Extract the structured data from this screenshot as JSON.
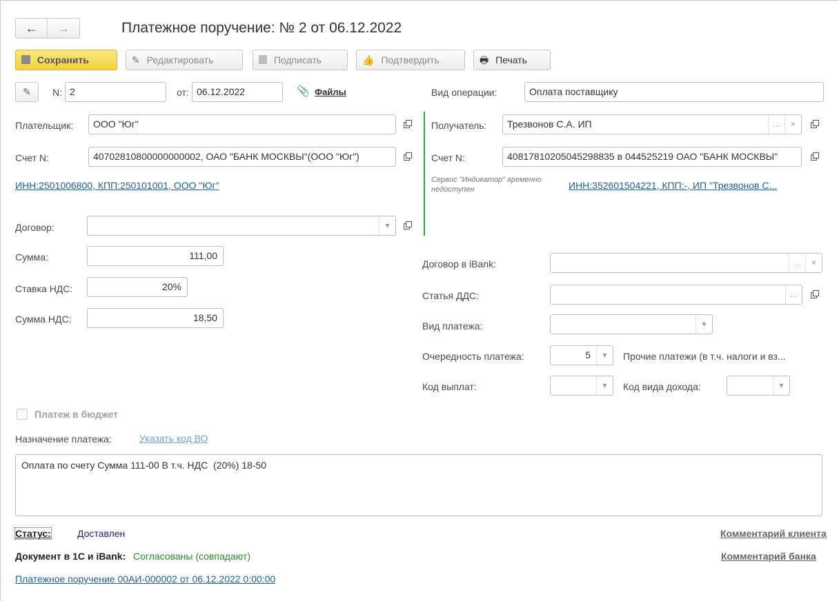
{
  "window": {
    "title": "Платежное поручение: № 2 от 06.12.2022"
  },
  "nav": {
    "back_icon": "arrow-left-icon",
    "forward_icon": "arrow-right-icon"
  },
  "toolbar": {
    "save": "Сохранить",
    "edit": "Редактировать",
    "sign": "Подписать",
    "confirm": "Подтвердить",
    "print": "Печать"
  },
  "doc": {
    "number_label": "N:",
    "number": "2",
    "date_label": "от:",
    "date": "06.12.2022",
    "files": "Файлы"
  },
  "operation": {
    "label": "Вид операции:",
    "value": "Оплата поставщику"
  },
  "payer": {
    "label": "Плательщик:",
    "value": "ООО \"Юг\"",
    "account_label": "Счет N:",
    "account": "40702810800000000002, ОАО \"БАНК МОСКВЫ\"(ООО \"Юг\")",
    "inn_link": "ИНН:2501006800, КПП:250101001, ООО \"Юг\""
  },
  "recipient": {
    "label": "Получатель:",
    "value": "Трезвонов С.А. ИП",
    "account_label": "Счет N:",
    "account": "40817810205045298835 в 044525219 ОАО \"БАНК МОСКВЫ\"",
    "service_note": "Сервис \"Индикатор\" временно недоступен",
    "inn_link": "ИНН:352601504221, КПП:-, ИП \"Трезвонов С..."
  },
  "contract": {
    "label": "Договор:",
    "value": ""
  },
  "amounts": {
    "sum_label": "Сумма:",
    "sum": "111,00",
    "vat_rate_label": "Ставка НДС:",
    "vat_rate": "20%",
    "vat_sum_label": "Сумма НДС:",
    "vat_sum": "18,50"
  },
  "ibank": {
    "contract_label": "Договор в iBank:",
    "contract": "",
    "dds_label": "Статья ДДС:",
    "dds": "",
    "payment_type_label": "Вид платежа:",
    "payment_type": "",
    "priority_label": "Очередность платежа:",
    "priority": "5",
    "priority_desc": "Прочие платежи (в т.ч. налоги и вз...",
    "payout_code_label": "Код выплат:",
    "payout_code": "",
    "income_code_label": "Код вида дохода:",
    "income_code": ""
  },
  "budget": {
    "label": "Платеж в бюджет",
    "checked": false
  },
  "purpose": {
    "label": "Назначение платежа:",
    "link": "Указать код ВО",
    "text": "Оплата по счету Сумма 111-00 В т.ч. НДС  (20%) 18-50"
  },
  "status": {
    "label": "Статус:",
    "value": "Доставлен",
    "compare_label": "Документ в 1С и iBank:",
    "compare_value": "Согласованы (совпадают)",
    "client_comment": "Комментарий клиента",
    "bank_comment": "Комментарий банка",
    "doc_link": "Платежное поручение 00АИ-000002 от 06.12.2022 0:00:00"
  },
  "colors": {
    "save_bg": "#f5d94c",
    "link": "#1f5ea8",
    "status_value": "#1a1a8c",
    "agreed": "#2e8b2e",
    "divider_green": "#2ca650"
  }
}
